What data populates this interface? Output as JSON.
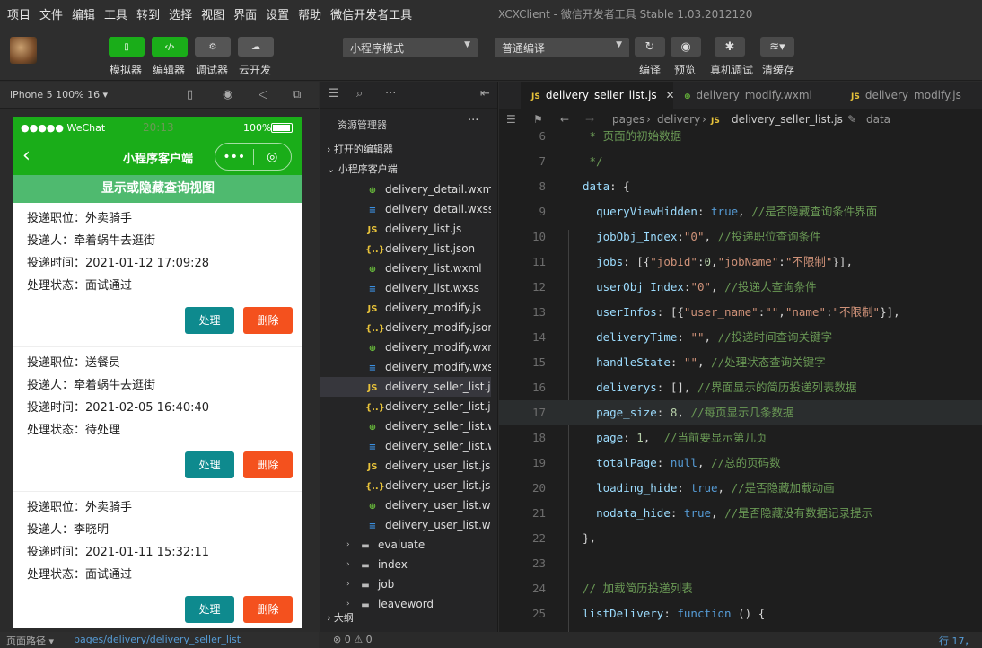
{
  "menubar": {
    "items": [
      "项目",
      "文件",
      "编辑",
      "工具",
      "转到",
      "选择",
      "视图",
      "界面",
      "设置",
      "帮助",
      "微信开发者工具"
    ],
    "app_title": "XCXClient - 微信开发者工具 Stable 1.03.2012120"
  },
  "toolbar": {
    "simulator": "模拟器",
    "editor": "编辑器",
    "debugger": "调试器",
    "cloud": "云开发",
    "mode_select": "小程序模式",
    "compile_select": "普通编译",
    "compile": "编译",
    "preview": "预览",
    "real_debug": "真机调试",
    "clear_cache": "清缓存"
  },
  "simulator": {
    "device": "iPhone 5 100% 16 ▾",
    "status_left": "●●●●● WeChat",
    "status_time": "20:13",
    "status_battery": "100%",
    "nav_title": "小程序客户端",
    "toggle_label": "显示或隐藏查询视图",
    "cards": [
      {
        "job": "投递职位：外卖骑手",
        "person": "投递人：牵着蜗牛去逛街",
        "time": "投递时间：2021-01-12 17:09:28",
        "state": "处理状态：面试通过"
      },
      {
        "job": "投递职位：送餐员",
        "person": "投递人：牵着蜗牛去逛街",
        "time": "投递时间：2021-02-05 16:40:40",
        "state": "处理状态：待处理"
      },
      {
        "job": "投递职位：外卖骑手",
        "person": "投递人：李晓明",
        "time": "投递时间：2021-01-11 15:32:11",
        "state": "处理状态：面试通过"
      }
    ],
    "handle_btn": "处理",
    "delete_btn": "删除",
    "footer_label": "页面路径 ▾",
    "footer_path": "pages/delivery/delivery_seller_list"
  },
  "explorer": {
    "title": "资源管理器",
    "more": "···",
    "open_editors": "打开的编辑器",
    "project": "小程序客户端",
    "outline": "大纲",
    "files": [
      {
        "name": "delivery_detail.wxml",
        "type": "wxml"
      },
      {
        "name": "delivery_detail.wxss",
        "type": "wxss"
      },
      {
        "name": "delivery_list.js",
        "type": "js"
      },
      {
        "name": "delivery_list.json",
        "type": "json"
      },
      {
        "name": "delivery_list.wxml",
        "type": "wxml"
      },
      {
        "name": "delivery_list.wxss",
        "type": "wxss"
      },
      {
        "name": "delivery_modify.js",
        "type": "js"
      },
      {
        "name": "delivery_modify.json",
        "type": "json"
      },
      {
        "name": "delivery_modify.wxml",
        "type": "wxml"
      },
      {
        "name": "delivery_modify.wxss",
        "type": "wxss"
      },
      {
        "name": "delivery_seller_list.js",
        "type": "js"
      },
      {
        "name": "delivery_seller_list.js...",
        "type": "json"
      },
      {
        "name": "delivery_seller_list.w...",
        "type": "wxml"
      },
      {
        "name": "delivery_seller_list.w...",
        "type": "wxss"
      },
      {
        "name": "delivery_user_list.js",
        "type": "js"
      },
      {
        "name": "delivery_user_list.json",
        "type": "json"
      },
      {
        "name": "delivery_user_list.wx...",
        "type": "wxml"
      },
      {
        "name": "delivery_user_list.wxss",
        "type": "wxss"
      }
    ],
    "folders": [
      "evaluate",
      "index",
      "job",
      "leaveword"
    ]
  },
  "editor": {
    "tabs": [
      "delivery_seller_list.js",
      "delivery_modify.wxml",
      "delivery_modify.js"
    ],
    "breadcrumb": [
      "pages",
      "delivery",
      "delivery_seller_list.js",
      "data"
    ],
    "status_left": "⊗ 0 ⚠ 0",
    "status_right": "行 17，"
  },
  "code_lines": [
    {
      "n": "6",
      "parts": [
        [
          "c",
          " * 页面的初始数据"
        ]
      ]
    },
    {
      "n": "7",
      "parts": [
        [
          "c",
          " */"
        ]
      ]
    },
    {
      "n": "8",
      "parts": [
        [
          "k",
          "data"
        ],
        [
          "p",
          ": {"
        ]
      ]
    },
    {
      "n": "9",
      "parts": [
        [
          "p",
          "  "
        ],
        [
          "k",
          "queryViewHidden"
        ],
        [
          "p",
          ": "
        ],
        [
          "b",
          "true"
        ],
        [
          "p",
          ", "
        ],
        [
          "c",
          "//是否隐藏查询条件界面"
        ]
      ]
    },
    {
      "n": "10",
      "parts": [
        [
          "p",
          "  "
        ],
        [
          "k",
          "jobObj_Index"
        ],
        [
          "p",
          ":"
        ],
        [
          "s",
          "\"0\""
        ],
        [
          "p",
          ", "
        ],
        [
          "c",
          "//投递职位查询条件"
        ]
      ]
    },
    {
      "n": "11",
      "parts": [
        [
          "p",
          "  "
        ],
        [
          "k",
          "jobs"
        ],
        [
          "p",
          ": [{"
        ],
        [
          "s",
          "\"jobId\""
        ],
        [
          "p",
          ":"
        ],
        [
          "n",
          "0"
        ],
        [
          "p",
          ","
        ],
        [
          "s",
          "\"jobName\""
        ],
        [
          "p",
          ":"
        ],
        [
          "s",
          "\"不限制\""
        ],
        [
          "p",
          "}],"
        ]
      ]
    },
    {
      "n": "12",
      "parts": [
        [
          "p",
          "  "
        ],
        [
          "k",
          "userObj_Index"
        ],
        [
          "p",
          ":"
        ],
        [
          "s",
          "\"0\""
        ],
        [
          "p",
          ", "
        ],
        [
          "c",
          "//投递人查询条件"
        ]
      ]
    },
    {
      "n": "13",
      "parts": [
        [
          "p",
          "  "
        ],
        [
          "k",
          "userInfos"
        ],
        [
          "p",
          ": [{"
        ],
        [
          "s",
          "\"user_name\""
        ],
        [
          "p",
          ":"
        ],
        [
          "s",
          "\"\""
        ],
        [
          "p",
          ","
        ],
        [
          "s",
          "\"name\""
        ],
        [
          "p",
          ":"
        ],
        [
          "s",
          "\"不限制\""
        ],
        [
          "p",
          "}],"
        ]
      ]
    },
    {
      "n": "14",
      "parts": [
        [
          "p",
          "  "
        ],
        [
          "k",
          "deliveryTime"
        ],
        [
          "p",
          ": "
        ],
        [
          "s",
          "\"\""
        ],
        [
          "p",
          ", "
        ],
        [
          "c",
          "//投递时间查询关键字"
        ]
      ]
    },
    {
      "n": "15",
      "parts": [
        [
          "p",
          "  "
        ],
        [
          "k",
          "handleState"
        ],
        [
          "p",
          ": "
        ],
        [
          "s",
          "\"\""
        ],
        [
          "p",
          ", "
        ],
        [
          "c",
          "//处理状态查询关键字"
        ]
      ]
    },
    {
      "n": "16",
      "parts": [
        [
          "p",
          "  "
        ],
        [
          "k",
          "deliverys"
        ],
        [
          "p",
          ": [], "
        ],
        [
          "c",
          "//界面显示的简历投递列表数据"
        ]
      ]
    },
    {
      "n": "17",
      "parts": [
        [
          "p",
          "  "
        ],
        [
          "k",
          "page_size"
        ],
        [
          "p",
          ": "
        ],
        [
          "n",
          "8"
        ],
        [
          "p",
          ", "
        ],
        [
          "c",
          "//每页显示几条数据"
        ]
      ]
    },
    {
      "n": "18",
      "parts": [
        [
          "p",
          "  "
        ],
        [
          "k",
          "page"
        ],
        [
          "p",
          ": "
        ],
        [
          "n",
          "1"
        ],
        [
          "p",
          ",  "
        ],
        [
          "c",
          "//当前要显示第几页"
        ]
      ]
    },
    {
      "n": "19",
      "parts": [
        [
          "p",
          "  "
        ],
        [
          "k",
          "totalPage"
        ],
        [
          "p",
          ": "
        ],
        [
          "b",
          "null"
        ],
        [
          "p",
          ", "
        ],
        [
          "c",
          "//总的页码数"
        ]
      ]
    },
    {
      "n": "20",
      "parts": [
        [
          "p",
          "  "
        ],
        [
          "k",
          "loading_hide"
        ],
        [
          "p",
          ": "
        ],
        [
          "b",
          "true"
        ],
        [
          "p",
          ", "
        ],
        [
          "c",
          "//是否隐藏加载动画"
        ]
      ]
    },
    {
      "n": "21",
      "parts": [
        [
          "p",
          "  "
        ],
        [
          "k",
          "nodata_hide"
        ],
        [
          "p",
          ": "
        ],
        [
          "b",
          "true"
        ],
        [
          "p",
          ", "
        ],
        [
          "c",
          "//是否隐藏没有数据记录提示"
        ]
      ]
    },
    {
      "n": "22",
      "parts": [
        [
          "p",
          "},"
        ]
      ]
    },
    {
      "n": "23",
      "parts": [
        [
          "p",
          ""
        ]
      ]
    },
    {
      "n": "24",
      "parts": [
        [
          "c",
          "// 加载简历投递列表"
        ]
      ]
    },
    {
      "n": "25",
      "parts": [
        [
          "k",
          "listDelivery"
        ],
        [
          "p",
          ": "
        ],
        [
          "b",
          "function"
        ],
        [
          "p",
          " () {"
        ]
      ]
    }
  ]
}
